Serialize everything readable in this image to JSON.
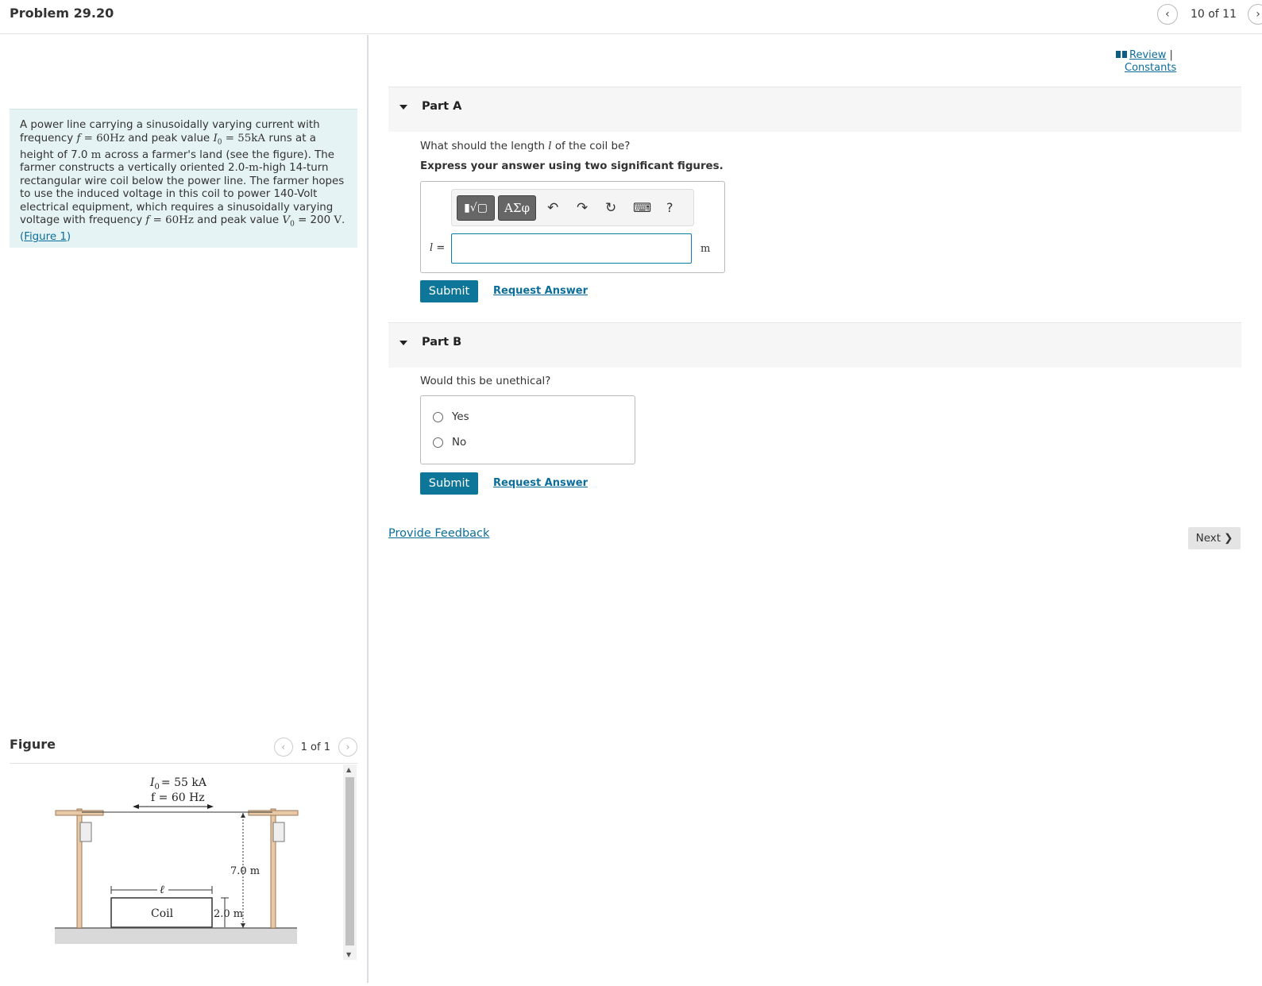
{
  "header": {
    "title": "Problem 29.20",
    "pager": "10 of 11"
  },
  "problem": {
    "intro": "A power line carrying a sinusoidally varying current with frequency",
    "f_sym": "f",
    "f_val": "= 60Hz",
    "peak_text": "and peak value",
    "i0_sym": "I",
    "i0_sub": "0",
    "i0_val": "= 55kA",
    "runs_text": "runs at a height of 7.0",
    "m_unit": "m",
    "body": "across a farmer's land (see the figure). The farmer constructs a vertically oriented 2.0-",
    "body_m": "m",
    "body_rest": "-high 14-turn rectangular wire coil below the power line. The farmer hopes to use the induced voltage in this coil to power 140-Volt electrical equipment, which requires a sinusoidally varying voltage with frequency",
    "f2_sym": "f",
    "f2_val": "= 60",
    "hz": "Hz",
    "and_peak": "and peak value",
    "v0_sym": "V",
    "v0_sub": "0",
    "v0_val": "= 200",
    "v_unit": "V",
    "period": ".",
    "figure_link": "Figure 1",
    "paren_open": "(",
    "paren_close": ")"
  },
  "figure": {
    "label": "Figure",
    "pager": "1 of 1",
    "i0_label": "= 55 kA",
    "i0_sym": "I",
    "i0_sub": "0",
    "f_label": "f = 60 Hz",
    "height_label": "7.0 m",
    "coil_label": "Coil",
    "coil_height": "2.0 m",
    "length_sym": "ℓ"
  },
  "sidebar_links": {
    "review": "Review",
    "sep": "|",
    "constants": "Constants"
  },
  "partA": {
    "label": "Part A",
    "question_pre": "What should the length",
    "question_sym": "l",
    "question_post": "of the coil be?",
    "instruction": "Express your answer using two significant figures.",
    "toolbar": {
      "templates": "▮√▢",
      "greek": "ΑΣφ",
      "undo": "↶",
      "redo": "↷",
      "reset": "↻",
      "keyboard": "⌨",
      "help": "?"
    },
    "answer_sym": "l",
    "answer_eq": "=",
    "answer_value": "",
    "unit": "m",
    "submit": "Submit",
    "request": "Request Answer"
  },
  "partB": {
    "label": "Part B",
    "question": "Would this be unethical?",
    "options": [
      "Yes",
      "No"
    ],
    "submit": "Submit",
    "request": "Request Answer"
  },
  "footer": {
    "feedback": "Provide Feedback",
    "next": "Next"
  },
  "colors": {
    "accent": "#0d7699",
    "problem_bg": "#e6f3f4",
    "link": "#0b6e9a"
  },
  "icons": {
    "prev": "chevron-left-icon",
    "next": "chevron-right-icon",
    "book": "book-icon",
    "caret": "caret-down-icon"
  }
}
